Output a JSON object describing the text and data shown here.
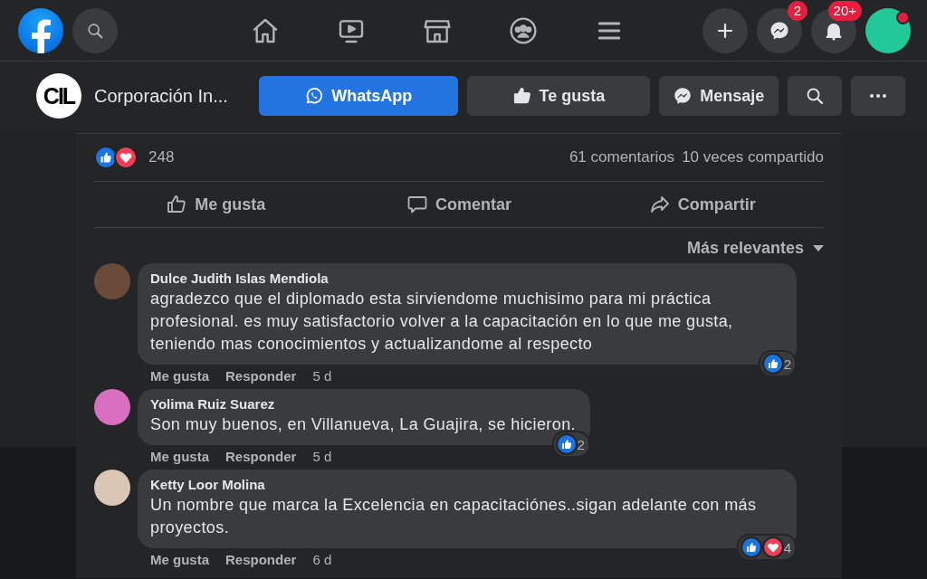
{
  "top_bar": {
    "nav": [
      {
        "kind": "home"
      },
      {
        "kind": "video"
      },
      {
        "kind": "marketplace"
      },
      {
        "kind": "groups"
      },
      {
        "kind": "menu"
      }
    ],
    "actions": [
      {
        "kind": "create"
      },
      {
        "kind": "messenger",
        "badge": "2"
      },
      {
        "kind": "notifications",
        "badge": "20+"
      }
    ]
  },
  "page_header": {
    "logo_text": "CIL",
    "title": "Corporación In...",
    "buttons": [
      {
        "kind": "whatsapp",
        "label": "WhatsApp"
      },
      {
        "kind": "like",
        "label": "Te gusta"
      },
      {
        "kind": "messenger",
        "label": "Mensaje"
      },
      {
        "kind": "search"
      },
      {
        "kind": "more"
      }
    ]
  },
  "post": {
    "reactions": [
      {
        "kind": "like"
      },
      {
        "kind": "love"
      }
    ],
    "reaction_count": "248",
    "comments_count": "61 comentarios",
    "shares_count": "10 veces compartido",
    "actions": [
      {
        "kind": "like",
        "label": "Me gusta"
      },
      {
        "kind": "comment",
        "label": "Comentar"
      },
      {
        "kind": "share",
        "label": "Compartir"
      }
    ],
    "sort": "Más relevantes",
    "comments": [
      {
        "author": "Dulce Judith Islas Mendiola",
        "text": "agradezco que el diplomado esta sirviendome muchisimo para mi práctica profesional. es muy satisfactorio volver a la capacitación en lo que me gusta, teniendo mas conocimientos y actualizandome al respecto",
        "like": "Me gusta",
        "reply": "Responder",
        "time": "5 d",
        "reactions": [
          {
            "kind": "like"
          }
        ],
        "reaction_count": "2"
      },
      {
        "author": "Yolima Ruiz Suarez",
        "text": "Son muy buenos, en Villanueva, La Guajira, se hicieron.",
        "like": "Me gusta",
        "reply": "Responder",
        "time": "5 d",
        "reactions": [
          {
            "kind": "like"
          }
        ],
        "reaction_count": "2"
      },
      {
        "author": "Ketty Loor Molina",
        "text": "Un nombre que marca la Excelencia en capacitaciónes..sigan adelante con más proyectos.",
        "like": "Me gusta",
        "reply": "Responder",
        "time": "6 d",
        "reactions": [
          {
            "kind": "like"
          },
          {
            "kind": "love"
          }
        ],
        "reaction_count": "4"
      }
    ]
  }
}
